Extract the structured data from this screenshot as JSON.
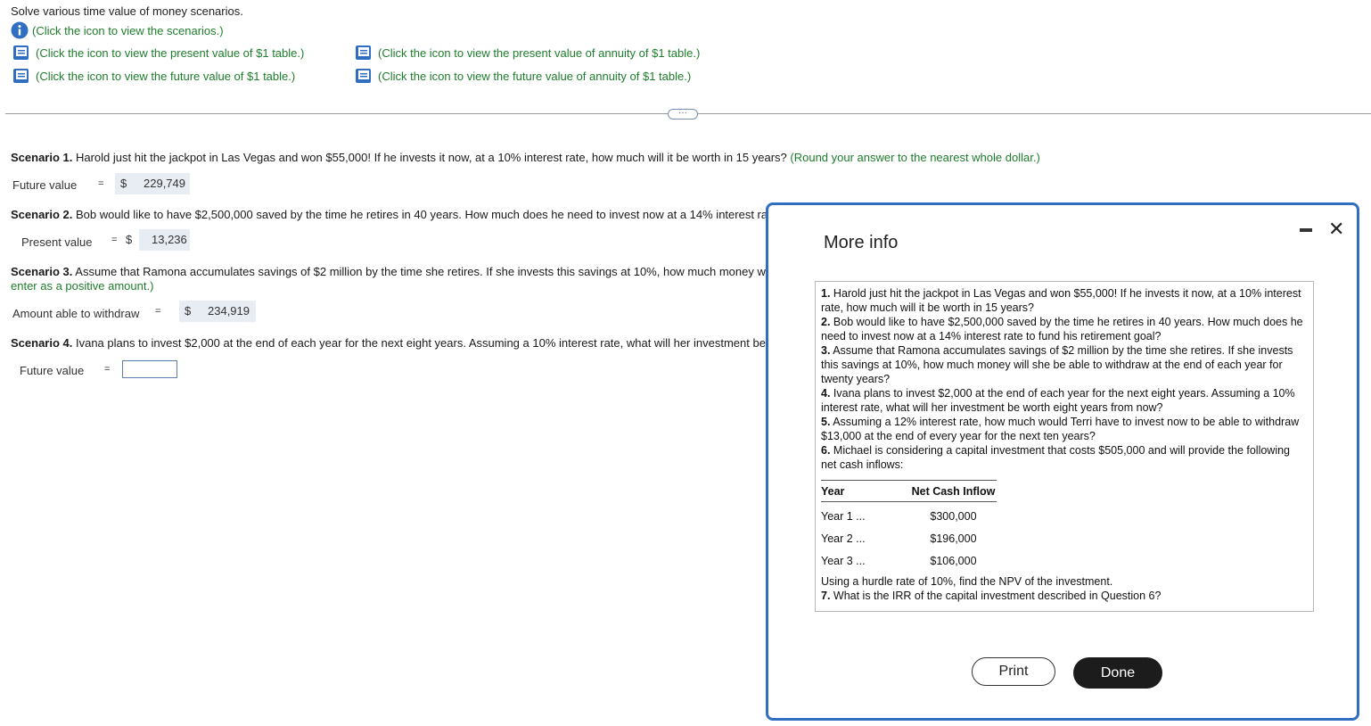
{
  "header": {
    "instruction": "Solve various time value of money scenarios.",
    "scenarios_link": "(Click the icon to view the scenarios.)",
    "links": {
      "pv_table": "(Click the icon to view the present value of $1 table.)",
      "fv_table": "(Click the icon to view the future value of $1 table.)",
      "pv_annuity_table": "(Click the icon to view the present value of annuity of $1 table.)",
      "fv_annuity_table": "(Click the icon to view the future value of annuity of $1 table.)"
    },
    "ellipsis": "···"
  },
  "scenarios": {
    "s1": {
      "label": "Scenario 1.",
      "text": " Harold just hit the jackpot in Las Vegas and won $55,000! If he invests it now, at a 10% interest rate, how much will it be worth in 15 years? ",
      "hint": "(Round your answer to the nearest whole dollar.)",
      "answer_label": "Future value",
      "eq": "=",
      "currency": "$",
      "answer": "229,749"
    },
    "s2": {
      "label": "Scenario 2.",
      "text": " Bob would like to have $2,500,000 saved by the time he retires in 40 years. How much does he need to invest now at a 14% interest ra",
      "answer_label": "Present value",
      "eq": "=",
      "currency": "$",
      "answer": "13,236"
    },
    "s3": {
      "label": "Scenario 3.",
      "text": " Assume that Ramona accumulates savings of $2 million by the time she retires. If she invests this savings at 10%, how much money w",
      "hint": "enter as a positive amount.)",
      "answer_label": "Amount able to withdraw",
      "eq": "=",
      "currency": "$",
      "answer": "234,919"
    },
    "s4": {
      "label": "Scenario 4.",
      "text": " Ivana plans to invest $2,000 at the end of each year for the next eight years. Assuming a 10% interest rate, what will her investment be",
      "answer_label": "Future value",
      "eq": "=",
      "answer": ""
    }
  },
  "dialog": {
    "title": "More info",
    "minimize": "–",
    "close": "✕",
    "items": [
      {
        "num": "1.",
        "text": " Harold just hit the jackpot in Las Vegas and won $55,000! If he invests it now, at a 10% interest rate, how much will it be worth in 15 years?"
      },
      {
        "num": "2.",
        "text": " Bob would like to have $2,500,000 saved by the time he retires in 40 years. How much does he need to invest now at a 14% interest rate to fund his retirement goal?"
      },
      {
        "num": "3.",
        "text": " Assume that Ramona accumulates savings of $2 million by the time she retires. If she invests this savings at 10%, how much money will she be able to withdraw at the end of each year for twenty years?"
      },
      {
        "num": "4.",
        "text": " Ivana plans to invest $2,000 at the end of each year for the next eight years. Assuming a 10% interest rate, what will her investment be worth eight years from now?"
      },
      {
        "num": "5.",
        "text": " Assuming a 12% interest rate, how much would Terri have to invest now to be able to withdraw $13,000 at the end of every year for the next ten years?"
      },
      {
        "num": "6.",
        "text": " Michael is considering a capital investment that costs $505,000 and will provide the following net cash inflows:"
      }
    ],
    "table": {
      "headers": [
        "Year",
        "Net Cash Inflow"
      ],
      "rows": [
        {
          "year": "Year 1",
          "dots": "...",
          "value": "$300,000"
        },
        {
          "year": "Year 2",
          "dots": "...",
          "value": "$196,000"
        },
        {
          "year": "Year 3",
          "dots": "...",
          "value": "$106,000"
        }
      ]
    },
    "after_table": "Using a hurdle rate of 10%, find the NPV of the investment.",
    "item7": {
      "num": "7.",
      "text": " What is the IRR of the capital investment described in Question 6?"
    },
    "print_label": "Print",
    "done_label": "Done"
  },
  "colors": {
    "link_green": "#1e7d2b",
    "icon_blue": "#2f6ec1",
    "answer_bg": "#e8ecf3",
    "dialog_border": "#2f6ec1",
    "done_bg": "#1c1c1c"
  }
}
